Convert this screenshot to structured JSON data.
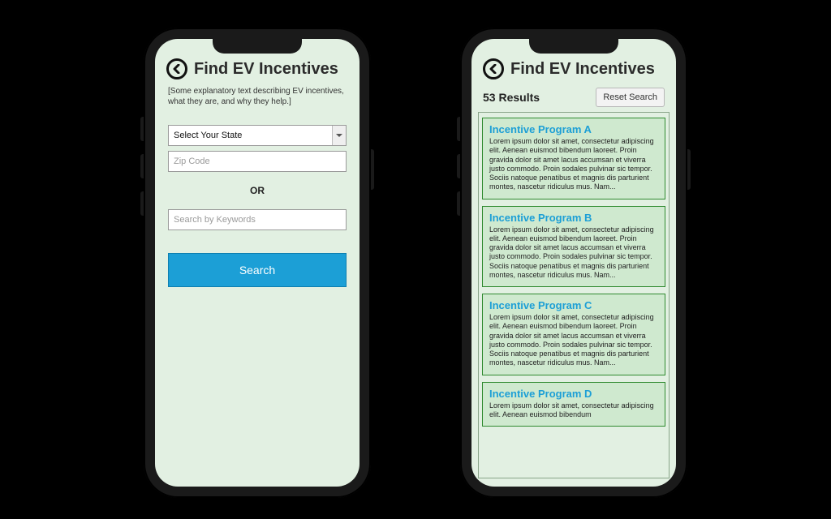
{
  "header": {
    "title": "Find EV Incentives"
  },
  "search": {
    "explain": "[Some explanatory text describing EV incentives, what they are, and why they help.]",
    "state_placeholder": "Select Your State",
    "zip_placeholder": "Zip Code",
    "or_label": "OR",
    "keyword_placeholder": "Search by Keywords",
    "search_label": "Search"
  },
  "results": {
    "count_label": "53 Results",
    "reset_label": "Reset Search",
    "items": [
      {
        "title": "Incentive Program A",
        "desc": "Lorem ipsum dolor sit amet, consectetur adipiscing elit. Aenean euismod bibendum laoreet. Proin gravida dolor sit amet lacus accumsan et viverra justo commodo. Proin sodales pulvinar sic tempor. Sociis natoque penatibus et magnis dis parturient montes, nascetur ridiculus mus. Nam..."
      },
      {
        "title": "Incentive Program B",
        "desc": "Lorem ipsum dolor sit amet, consectetur adipiscing elit. Aenean euismod bibendum laoreet. Proin gravida dolor sit amet lacus accumsan et viverra justo commodo. Proin sodales pulvinar sic tempor. Sociis natoque penatibus et magnis dis parturient montes, nascetur ridiculus mus. Nam..."
      },
      {
        "title": "Incentive Program C",
        "desc": "Lorem ipsum dolor sit amet, consectetur adipiscing elit. Aenean euismod bibendum laoreet. Proin gravida dolor sit amet lacus accumsan et viverra justo commodo. Proin sodales pulvinar sic tempor. Sociis natoque penatibus et magnis dis parturient montes, nascetur ridiculus mus. Nam..."
      },
      {
        "title": "Incentive Program D",
        "desc": "Lorem ipsum dolor sit amet, consectetur adipiscing elit. Aenean euismod bibendum"
      }
    ]
  }
}
